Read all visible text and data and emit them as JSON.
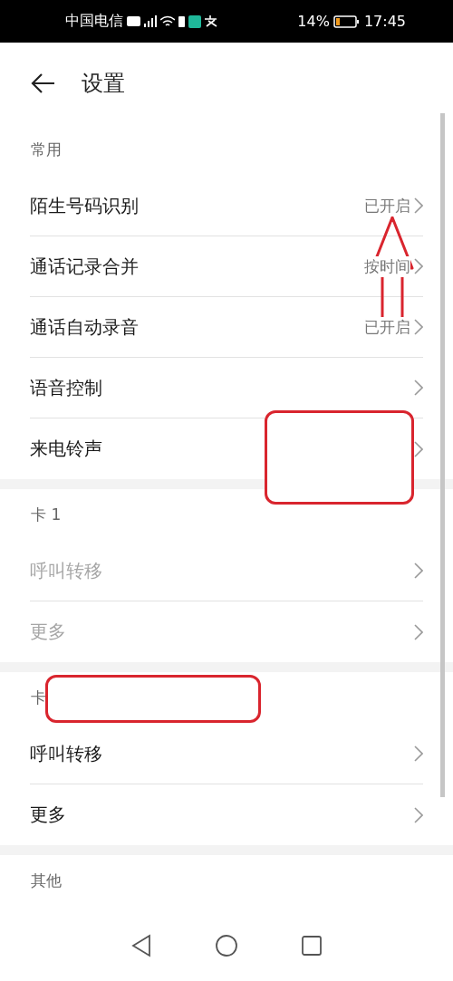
{
  "status_bar": {
    "carrier": "中国电信",
    "battery_percent": "14%",
    "time": "17:45"
  },
  "header": {
    "title": "设置"
  },
  "sections": [
    {
      "title": "常用",
      "items": [
        {
          "label": "陌生号码识别",
          "value": "已开启",
          "disabled": false
        },
        {
          "label": "通话记录合并",
          "value": "按时间",
          "disabled": false
        },
        {
          "label": "通话自动录音",
          "value": "已开启",
          "disabled": false
        },
        {
          "label": "语音控制",
          "disabled": false
        },
        {
          "label": "来电铃声",
          "disabled": false
        }
      ]
    },
    {
      "title": "卡 1",
      "items": [
        {
          "label": "呼叫转移",
          "disabled": true
        },
        {
          "label": "更多",
          "disabled": true
        }
      ]
    },
    {
      "title": "卡",
      "items": [
        {
          "label": "呼叫转移",
          "disabled": false
        },
        {
          "label": "更多",
          "disabled": false
        }
      ]
    },
    {
      "title": "其他"
    }
  ]
}
